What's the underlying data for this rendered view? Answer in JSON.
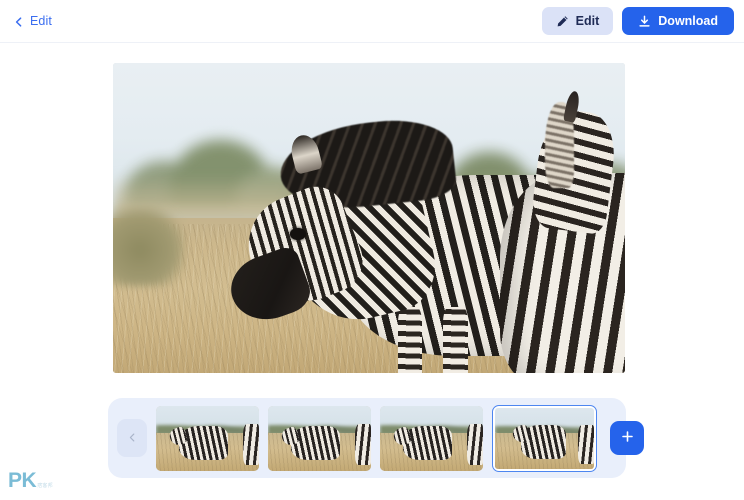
{
  "header": {
    "back": {
      "label": "Edit",
      "icon": "chevron-left-icon"
    },
    "actions": [
      {
        "id": "edit",
        "label": "Edit",
        "icon": "pencil-icon",
        "style": "secondary",
        "bg": "#dbe2f7",
        "fg": "#1f2b56"
      },
      {
        "id": "download",
        "label": "Download",
        "icon": "download-icon",
        "style": "primary",
        "bg": "#2563eb",
        "fg": "#ffffff"
      }
    ]
  },
  "preview": {
    "alt": "Two zebras standing in tall dry golden grass on a savanna with blurred green trees and pale blue sky"
  },
  "filmstrip": {
    "prev_icon": "chevron-left-icon",
    "add_icon": "plus-icon",
    "selected_index": 3,
    "thumbnails": [
      {
        "index": 0,
        "alt": "zebra in grass thumbnail",
        "selected": false
      },
      {
        "index": 1,
        "alt": "zebra in grass thumbnail",
        "selected": false
      },
      {
        "index": 2,
        "alt": "zebra in grass thumbnail",
        "selected": false
      },
      {
        "index": 3,
        "alt": "zebra in grass thumbnail",
        "selected": true
      }
    ]
  },
  "watermark": {
    "mark": "PK",
    "sub": "痞客邦"
  },
  "colors": {
    "accent": "#2563eb",
    "accent_soft": "#dbe2f7",
    "link": "#3b6ef0",
    "strip_bg": "#e9effb",
    "selected_border": "#4d86f0",
    "page_bg": "#ffffff"
  }
}
